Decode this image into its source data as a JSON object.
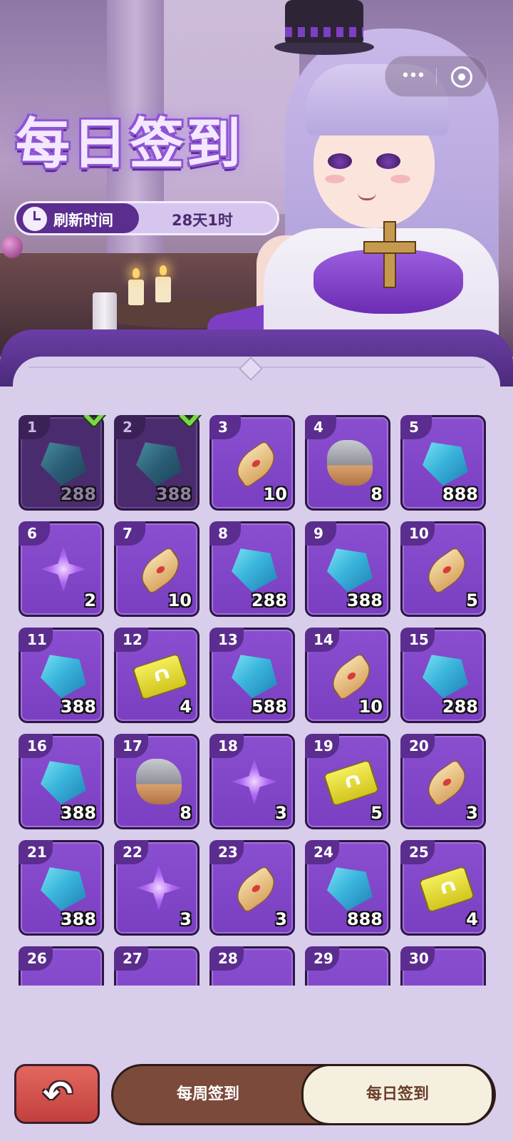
{
  "header": {
    "title": "每日签到",
    "refresh_label": "刷新时间",
    "refresh_value": "28天1时"
  },
  "capsule": {
    "menu_icon": "more-dots-icon",
    "close_icon": "target-circle-icon"
  },
  "days": [
    {
      "day": "1",
      "item": "blue-crystal-icon",
      "qty": "288",
      "claimed": true
    },
    {
      "day": "2",
      "item": "blue-crystal-icon",
      "qty": "388",
      "claimed": true
    },
    {
      "day": "3",
      "item": "scroll-icon",
      "qty": "10",
      "claimed": false
    },
    {
      "day": "4",
      "item": "ore-stone-icon",
      "qty": "8",
      "claimed": false
    },
    {
      "day": "5",
      "item": "blue-crystal-icon",
      "qty": "888",
      "claimed": false
    },
    {
      "day": "6",
      "item": "purple-star-icon",
      "qty": "2",
      "claimed": false
    },
    {
      "day": "7",
      "item": "scroll-icon",
      "qty": "10",
      "claimed": false
    },
    {
      "day": "8",
      "item": "blue-crystal-icon",
      "qty": "288",
      "claimed": false
    },
    {
      "day": "9",
      "item": "blue-crystal-icon",
      "qty": "388",
      "claimed": false
    },
    {
      "day": "10",
      "item": "scroll-icon",
      "qty": "5",
      "claimed": false
    },
    {
      "day": "11",
      "item": "blue-crystal-icon",
      "qty": "388",
      "claimed": false
    },
    {
      "day": "12",
      "item": "gold-ticket-icon",
      "qty": "4",
      "claimed": false
    },
    {
      "day": "13",
      "item": "blue-crystal-icon",
      "qty": "588",
      "claimed": false
    },
    {
      "day": "14",
      "item": "scroll-icon",
      "qty": "10",
      "claimed": false
    },
    {
      "day": "15",
      "item": "blue-crystal-icon",
      "qty": "288",
      "claimed": false
    },
    {
      "day": "16",
      "item": "blue-crystal-icon",
      "qty": "388",
      "claimed": false
    },
    {
      "day": "17",
      "item": "ore-stone-icon",
      "qty": "8",
      "claimed": false
    },
    {
      "day": "18",
      "item": "purple-star-icon",
      "qty": "3",
      "claimed": false
    },
    {
      "day": "19",
      "item": "gold-ticket-icon",
      "qty": "5",
      "claimed": false
    },
    {
      "day": "20",
      "item": "scroll-icon",
      "qty": "3",
      "claimed": false
    },
    {
      "day": "21",
      "item": "blue-crystal-icon",
      "qty": "388",
      "claimed": false
    },
    {
      "day": "22",
      "item": "purple-star-icon",
      "qty": "3",
      "claimed": false
    },
    {
      "day": "23",
      "item": "scroll-icon",
      "qty": "3",
      "claimed": false
    },
    {
      "day": "24",
      "item": "blue-crystal-icon",
      "qty": "888",
      "claimed": false
    },
    {
      "day": "25",
      "item": "gold-ticket-icon",
      "qty": "4",
      "claimed": false
    },
    {
      "day": "26",
      "item": "",
      "qty": "",
      "claimed": false
    },
    {
      "day": "27",
      "item": "",
      "qty": "",
      "claimed": false
    },
    {
      "day": "28",
      "item": "",
      "qty": "",
      "claimed": false
    },
    {
      "day": "29",
      "item": "",
      "qty": "",
      "claimed": false
    },
    {
      "day": "30",
      "item": "",
      "qty": "",
      "claimed": false
    }
  ],
  "footer": {
    "back_icon": "back-arrow-icon",
    "tab_weekly": "每周签到",
    "tab_daily": "每日签到",
    "active_tab": "每日签到"
  },
  "colors": {
    "accent_purple": "#7a3fc0",
    "claimed_cell": "#4a2c6e",
    "panel_bg": "#d9cdec",
    "back_button": "#c3403c",
    "tab_bar": "#7c4a3a"
  }
}
